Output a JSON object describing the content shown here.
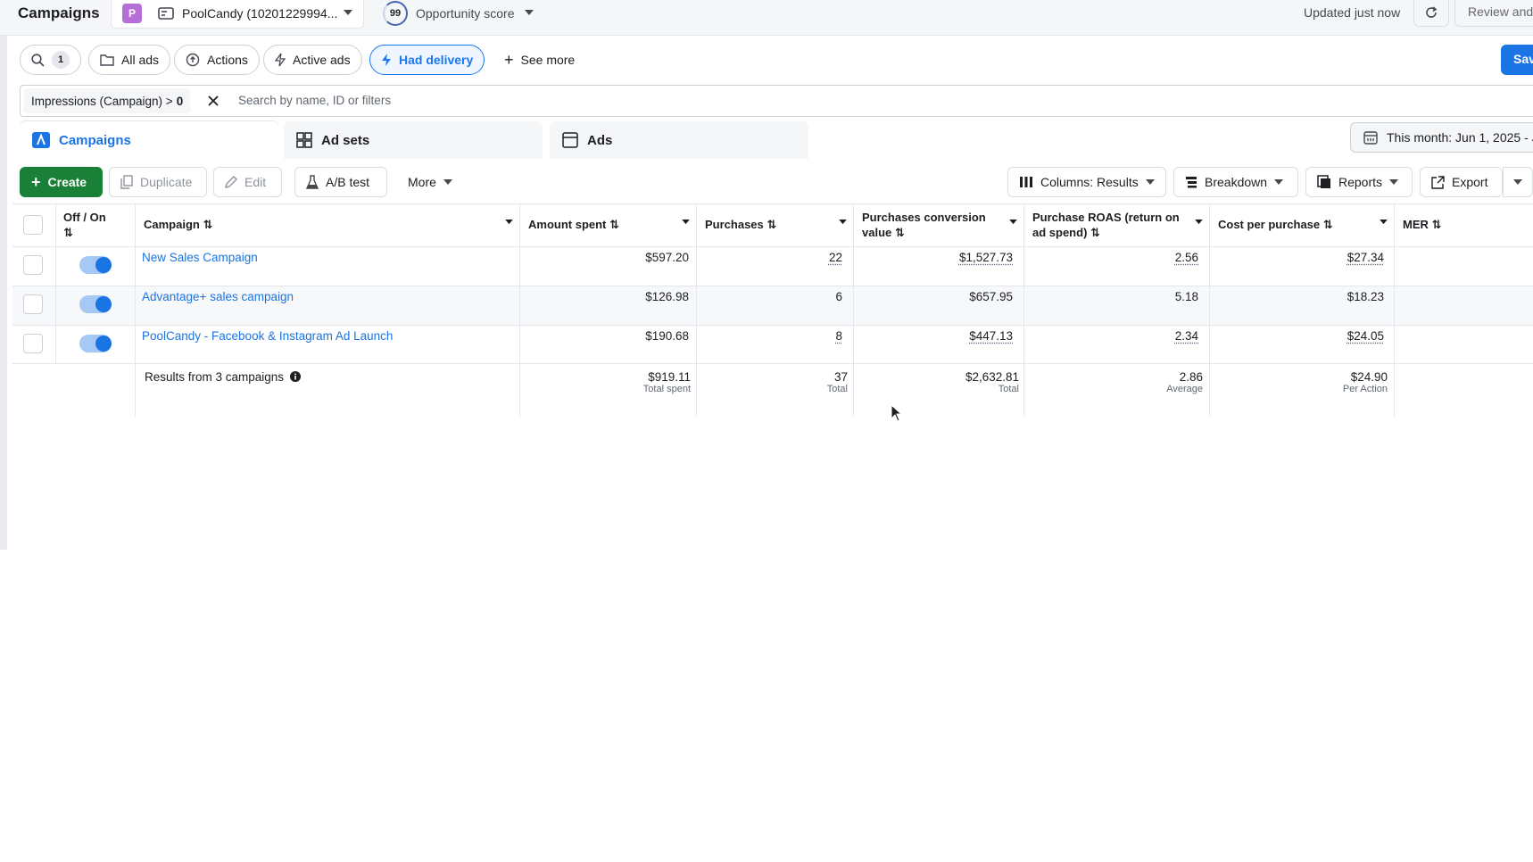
{
  "header": {
    "title": "Campaigns",
    "account_initial": "P",
    "account_name": "PoolCandy (10201229994...",
    "opportunity_score": "99",
    "opportunity_label": "Opportunity score",
    "updated": "Updated just now",
    "review_label": "Review and"
  },
  "filters": {
    "search_count": "1",
    "all_ads": "All ads",
    "actions": "Actions",
    "active_ads": "Active ads",
    "had_delivery": "Had delivery",
    "see_more": "See more",
    "save": "Sav"
  },
  "filterbar": {
    "token_prefix": "Impressions (Campaign) > ",
    "token_value": "0",
    "search_placeholder": "Search by name, ID or filters"
  },
  "tabs": {
    "campaigns": "Campaigns",
    "ad_sets": "Ad sets",
    "ads": "Ads",
    "date_range": "This month: Jun 1, 2025 - J"
  },
  "toolbar": {
    "create": "Create",
    "duplicate": "Duplicate",
    "edit": "Edit",
    "ab_test": "A/B test",
    "more": "More",
    "columns": "Columns: Results",
    "breakdown": "Breakdown",
    "reports": "Reports",
    "export": "Export"
  },
  "table": {
    "headers": {
      "off_on": "Off / On",
      "campaign": "Campaign",
      "amount_spent": "Amount spent",
      "purchases": "Purchases",
      "pcv_line1": "Purchases conversion",
      "pcv_line2": "value",
      "roas_line1": "Purchase ROAS (return on",
      "roas_line2": "ad spend)",
      "cpp": "Cost per purchase",
      "mer": "MER"
    },
    "rows": [
      {
        "name": "New Sales Campaign",
        "spent": "$597.20",
        "purchases": "22",
        "pcv": "$1,527.73",
        "roas": "2.56",
        "cpp": "$27.34"
      },
      {
        "name": "Advantage+ sales campaign",
        "spent": "$126.98",
        "purchases": "6",
        "pcv": "$657.95",
        "roas": "5.18",
        "cpp": "$18.23"
      },
      {
        "name": "PoolCandy - Facebook & Instagram Ad Launch",
        "spent": "$190.68",
        "purchases": "8",
        "pcv": "$447.13",
        "roas": "2.34",
        "cpp": "$24.05"
      }
    ],
    "totals": {
      "label": "Results from 3 campaigns",
      "spent": "$919.11",
      "spent_sub": "Total spent",
      "purchases": "37",
      "purchases_sub": "Total",
      "pcv": "$2,632.81",
      "pcv_sub": "Total",
      "roas": "2.86",
      "roas_sub": "Average",
      "cpp": "$24.90",
      "cpp_sub": "Per Action"
    }
  },
  "colors": {
    "accent": "#1b74e4",
    "create": "#1a7f37"
  }
}
